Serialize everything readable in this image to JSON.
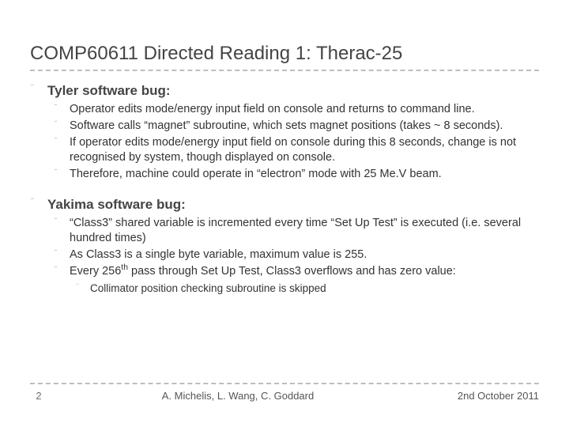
{
  "title": "COMP60611 Directed Reading 1: Therac-25",
  "sections": [
    {
      "heading": "Tyler software bug:",
      "items": [
        "Operator edits mode/energy input field on console and returns to command line.",
        "Software calls “magnet” subroutine, which sets magnet positions (takes ~ 8 seconds).",
        "If operator edits mode/energy input field on console during this 8 seconds, change is not recognised by system, though displayed on console.",
        "Therefore, machine could operate in “electron” mode with 25 Me.V beam."
      ]
    },
    {
      "heading": "Yakima software bug:",
      "items": [
        "“Class3” shared variable is incremented every time “Set Up Test” is executed (i.e. several hundred times)",
        "As Class3 is a single byte variable, maximum value is 255.",
        "Every 256th pass through Set Up Test, Class3 overflows and has zero value:"
      ],
      "subitems": [
        "Collimator position checking subroutine is skipped"
      ]
    }
  ],
  "footer": {
    "page": "2",
    "authors": "A. Michelis, L. Wang, C. Goddard",
    "date": "2nd October 2011"
  },
  "glyph": "ؔ"
}
